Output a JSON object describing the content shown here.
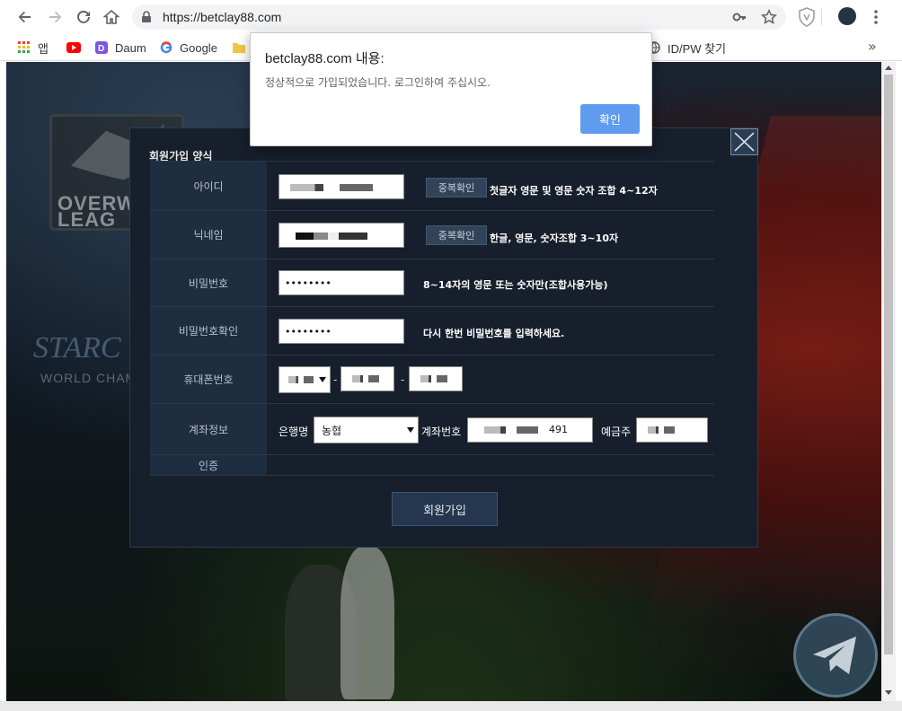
{
  "browser": {
    "url": "https://betclay88.com",
    "bookmarks": [
      {
        "label": "앱",
        "icon": "apps-grid-icon"
      },
      {
        "label": "",
        "icon": "youtube-icon"
      },
      {
        "label": "Daum",
        "icon": "daum-icon"
      },
      {
        "label": "Google",
        "icon": "google-icon"
      },
      {
        "label": "",
        "icon": "folder-icon"
      },
      {
        "label": "ID/PW 찾기",
        "icon": "globe-icon"
      }
    ],
    "more": "»"
  },
  "alert": {
    "title": "betclay88.com 내용:",
    "message": "정상적으로 가입되었습니다. 로그인하여 주십시오.",
    "ok_label": "확인"
  },
  "signup": {
    "title": "회원가입 양식",
    "rows": {
      "id": {
        "label": "아이디",
        "dup_label": "중복확인",
        "hint": "첫글자 영문 및 영문 숫자 조합 4~12자"
      },
      "nickname": {
        "label": "닉네임",
        "dup_label": "중복확인",
        "hint": "한글, 영문, 숫자조합 3~10자"
      },
      "password": {
        "label": "비밀번호",
        "value": "••••••••",
        "hint": "8~14자의 영문 또는 숫자만(조합사용가능)"
      },
      "password_confirm": {
        "label": "비밀번호확인",
        "value": "••••••••",
        "hint": "다시 한번 비밀번호를 입력하세요."
      },
      "phone": {
        "label": "휴대폰번호",
        "sep": "-"
      },
      "account": {
        "label": "계좌정보",
        "bank_label": "은행명",
        "bank_value": "농협",
        "number_label": "계좌번호",
        "number_suffix": "491",
        "holder_label": "예금주"
      },
      "auth": {
        "label": "인증"
      }
    },
    "submit_label": "회원가입"
  },
  "background": {
    "overwatch_text": "OVERWA\nLEAG",
    "starcraft_text": "STARC",
    "starcraft_sub": "WORLD CHAM"
  }
}
